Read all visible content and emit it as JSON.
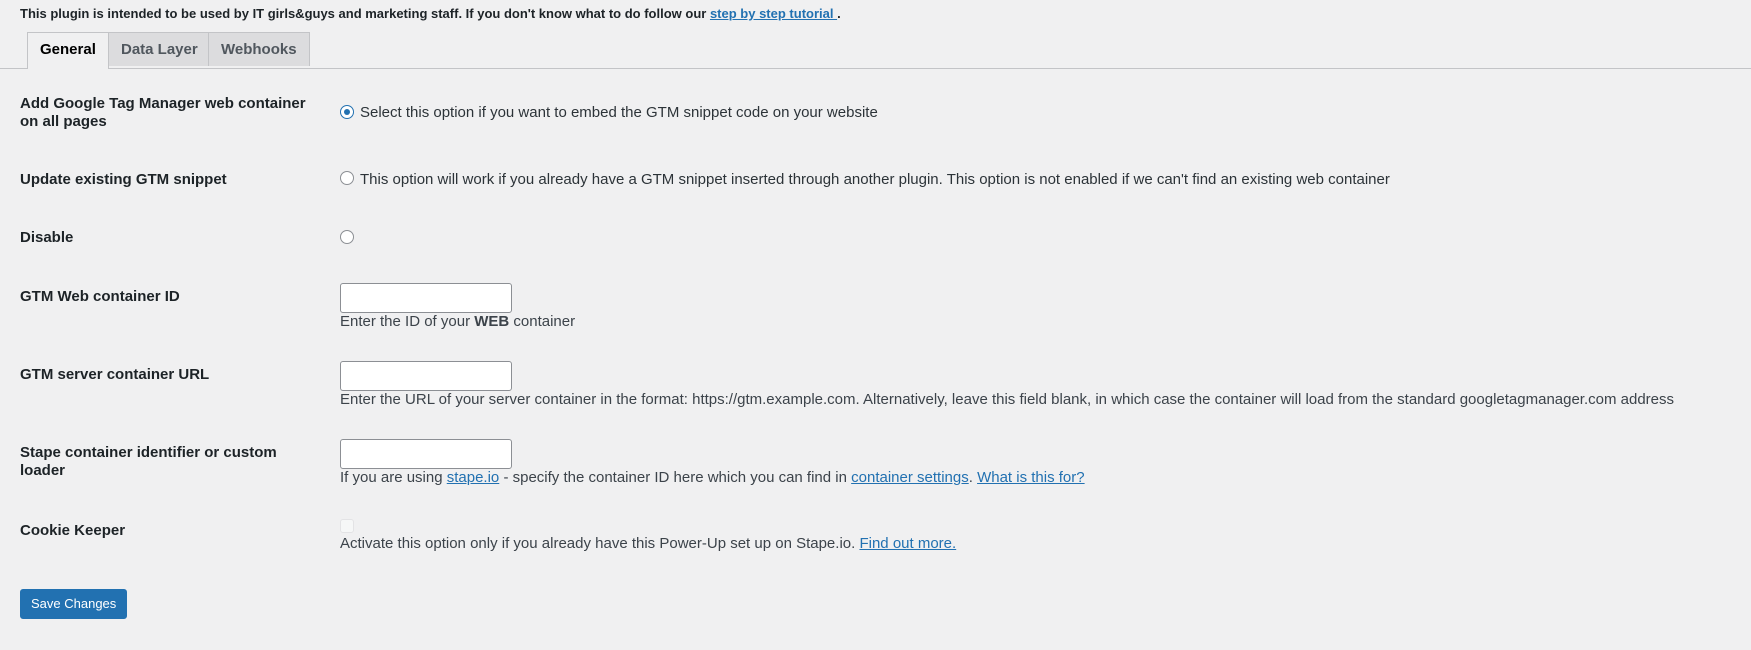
{
  "intro": {
    "text": "This plugin is intended to be used by IT girls&guys and marketing staff. If you don't know what to do follow our ",
    "link": "step by step tutorial ",
    "suffix": "."
  },
  "tabs": [
    {
      "label": "General",
      "active": true
    },
    {
      "label": "Data Layer",
      "active": false
    },
    {
      "label": "Webhooks",
      "active": false
    }
  ],
  "fields": {
    "add_gtm": {
      "label": "Add Google Tag Manager web container on all pages",
      "option_text": "Select this option if you want to embed the GTM snippet code on your website"
    },
    "update_gtm": {
      "label": "Update existing GTM snippet",
      "option_text": "This option will work if you already have a GTM snippet inserted through another plugin. This option is not enabled if we can't find an existing web container"
    },
    "disable": {
      "label": "Disable"
    },
    "web_container_id": {
      "label": "GTM Web container ID",
      "value": "",
      "desc_pre": "Enter the ID of your ",
      "desc_bold": "WEB",
      "desc_post": " container"
    },
    "server_container_url": {
      "label": "GTM server container URL",
      "value": "",
      "desc": "Enter the URL of your server container in the format: https://gtm.example.com. Alternatively, leave this field blank, in which case the container will load from the standard googletagmanager.com address"
    },
    "stape_identifier": {
      "label": "Stape container identifier or custom loader",
      "value": "",
      "desc_pre": "If you are using ",
      "link1": "stape.io",
      "desc_mid": " - specify the container ID here which you can find in ",
      "link2": "container settings",
      "desc_sep": ". ",
      "link3": "What is this for?"
    },
    "cookie_keeper": {
      "label": "Cookie Keeper",
      "desc": "Activate this option only if you already have this Power-Up set up on Stape.io. ",
      "link": "Find out more."
    }
  },
  "save_label": "Save Changes",
  "colors": {
    "accent": "#2271b1",
    "background": "#f0f0f1",
    "text": "#1d2327"
  }
}
